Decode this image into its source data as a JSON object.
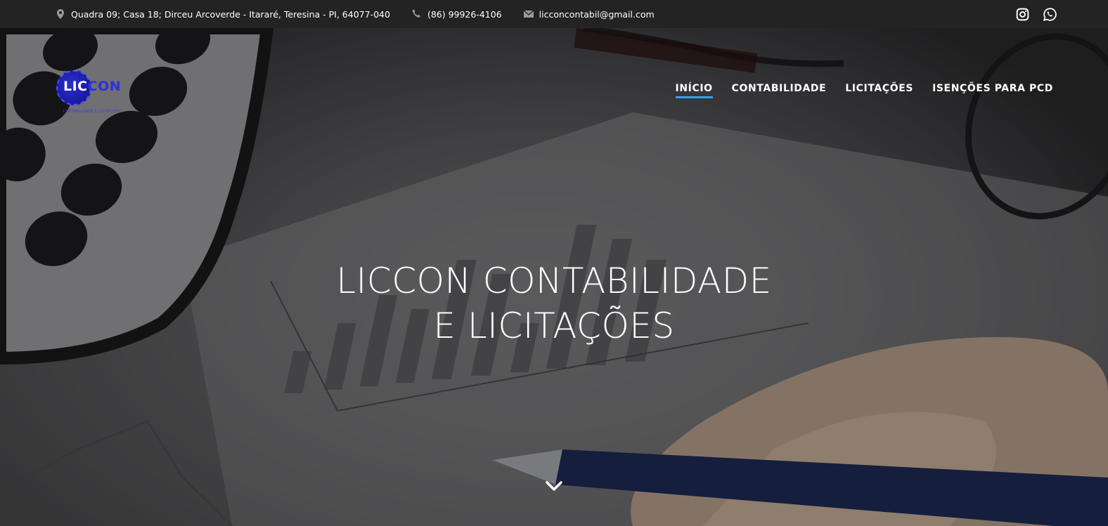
{
  "topbar": {
    "address": "Quadra 09; Casa 18; Dirceu Arcoverde - Itararé, Teresina - PI, 64077-040",
    "phone": "(86) 99926-4106",
    "email": "licconcontabil@gmail.com",
    "social": [
      {
        "icon": "instagram-icon"
      },
      {
        "icon": "whatsapp-icon"
      }
    ]
  },
  "logo": {
    "part1": "LIC",
    "part2": "CON",
    "subtitle": "CONTABILIDADE E LICITAÇÕES"
  },
  "nav": {
    "items": [
      {
        "label": "INÍCIO",
        "active": true
      },
      {
        "label": "CONTABILIDADE"
      },
      {
        "label": "LICITAÇÕES"
      },
      {
        "label": "ISENÇÕES PARA PCD"
      }
    ]
  },
  "hero": {
    "line1": "LICCON CONTABILIDADE",
    "line2": "E LICITAÇÕES",
    "scroll_icon": "chevron-down-icon"
  },
  "colors": {
    "topbar_bg": "#232323",
    "accent": "#2ea3f2",
    "logo_blue": "#2b2fd8"
  }
}
